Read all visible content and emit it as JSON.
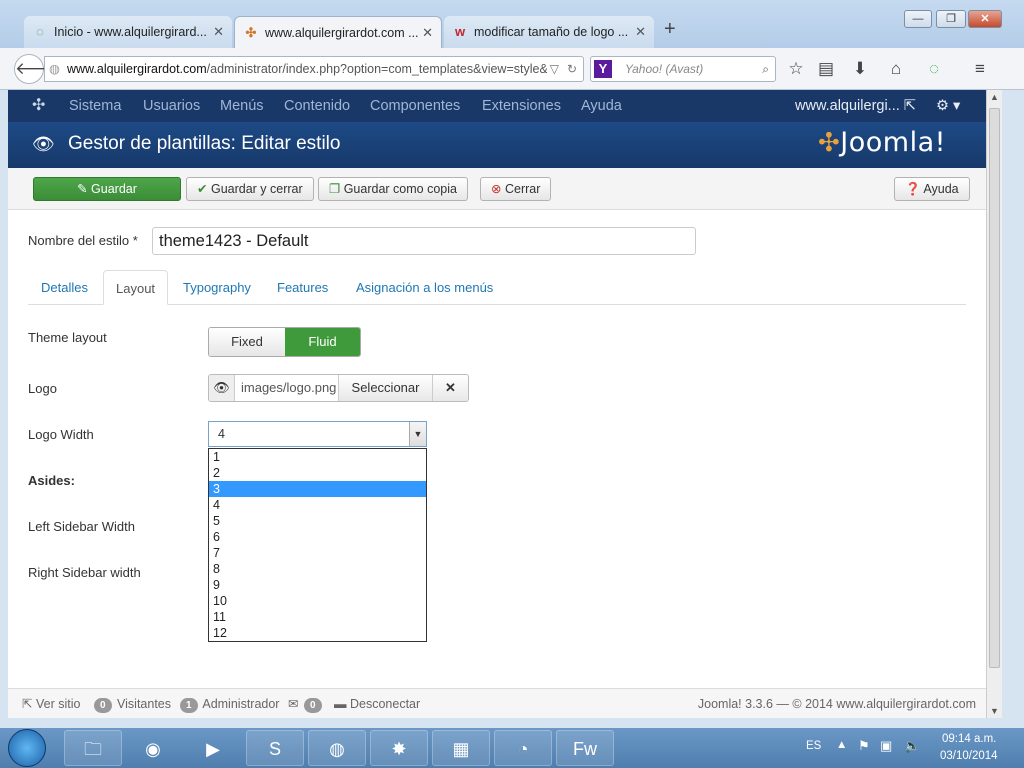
{
  "browser": {
    "tabs": [
      {
        "label": "Inicio - www.alquilergirard...",
        "icon": "loading-circle-icon",
        "active": false
      },
      {
        "label": "www.alquilergirardot.com ...",
        "icon": "joomla-favicon-icon",
        "active": true
      },
      {
        "label": "modificar tamaño de logo ...",
        "icon": "w-favicon-icon",
        "active": false
      }
    ],
    "url_domain": "www.alquilergirardot.com",
    "url_path": "/administrator/index.php?option=com_templates&view=style&",
    "search_placeholder": "Yahoo! (Avast)"
  },
  "joomla": {
    "nav_items": [
      "Sistema",
      "Usuarios",
      "Menús",
      "Contenido",
      "Componentes",
      "Extensiones",
      "Ayuda"
    ],
    "site_link": "www.alquilergi...",
    "page_title": "Gestor de plantillas: Editar estilo",
    "brand": "Joomla!",
    "toolbar": {
      "save": "Guardar",
      "save_close": "Guardar y cerrar",
      "save_copy": "Guardar como copia",
      "close": "Cerrar",
      "help": "Ayuda"
    },
    "style_name_label": "Nombre del estilo *",
    "style_name_value": "theme1423 - Default",
    "tabs": [
      "Detalles",
      "Layout",
      "Typography",
      "Features",
      "Asignación a los menús"
    ],
    "active_tab": "Layout",
    "fields": {
      "theme_layout_label": "Theme layout",
      "layout_fixed": "Fixed",
      "layout_fluid": "Fluid",
      "layout_selected": "Fluid",
      "logo_label": "Logo",
      "logo_path": "images/logo.png",
      "logo_select": "Seleccionar",
      "logo_width_label": "Logo Width",
      "logo_width_value": "4",
      "logo_width_options": [
        "1",
        "2",
        "3",
        "4",
        "5",
        "6",
        "7",
        "8",
        "9",
        "10",
        "11",
        "12"
      ],
      "logo_width_highlighted": "3",
      "asides_label": "Asides:",
      "left_sidebar_label": "Left Sidebar Width",
      "right_sidebar_label": "Right Sidebar width"
    },
    "footer": {
      "view_site": "Ver sitio",
      "visitors_count": "0",
      "visitors_label": "Visitantes",
      "admins_count": "1",
      "admins_label": "Administrador",
      "messages_count": "0",
      "logout": "Desconectar",
      "version": "Joomla! 3.3.6",
      "copyright": "— © 2014 www.alquilergirardot.com"
    }
  },
  "taskbar": {
    "language": "ES",
    "time": "09:14 a.m.",
    "date": "03/10/2014"
  },
  "colors": {
    "joomla_nav": "#1a3867",
    "save_green": "#3f9a3b",
    "link_blue": "#1f78b4",
    "option_highlight": "#3399ff"
  }
}
